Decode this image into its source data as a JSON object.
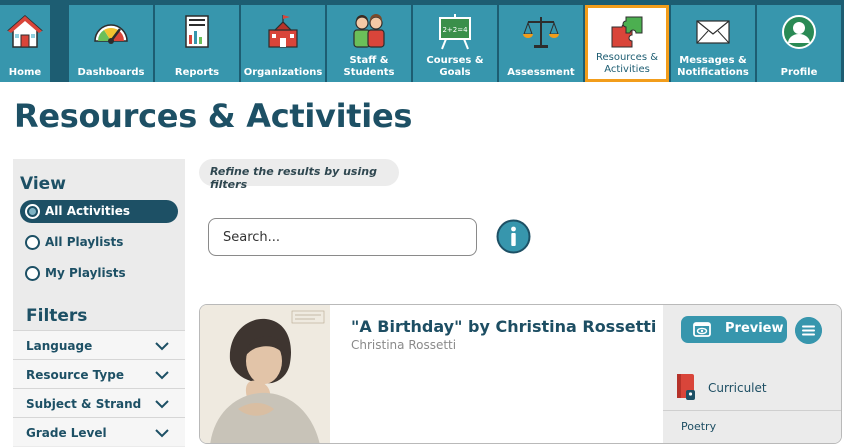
{
  "nav": {
    "items": [
      {
        "label": "Home",
        "icon": "house-icon"
      },
      {
        "label": "Dashboards",
        "icon": "gauge-icon"
      },
      {
        "label": "Reports",
        "icon": "report-icon"
      },
      {
        "label": "Organizations",
        "icon": "school-building-icon"
      },
      {
        "label": "Staff & Students",
        "icon": "people-icon"
      },
      {
        "label": "Courses & Goals",
        "icon": "chalkboard-icon"
      },
      {
        "label": "Assessment",
        "icon": "scales-icon"
      },
      {
        "label": "Resources & Activities",
        "icon": "puzzle-icon",
        "active": true
      },
      {
        "label": "Messages & Notifications",
        "icon": "envelope-icon"
      },
      {
        "label": "Profile",
        "icon": "user-icon"
      }
    ],
    "active_border_color": "#f29d1b",
    "bar_color": "#3796ad"
  },
  "page": {
    "title": "Resources & Activities"
  },
  "sidebar": {
    "view_heading": "View",
    "view_options": [
      {
        "label": "All Activities",
        "selected": true
      },
      {
        "label": "All Playlists",
        "selected": false
      },
      {
        "label": "My Playlists",
        "selected": false
      }
    ],
    "filters_heading": "Filters",
    "filters": [
      {
        "label": "Language"
      },
      {
        "label": "Resource Type"
      },
      {
        "label": "Subject & Strand"
      },
      {
        "label": "Grade Level"
      }
    ]
  },
  "main": {
    "refine_text": "Refine the results by using filters",
    "search": {
      "placeholder": "Search...",
      "value": ""
    },
    "info_icon": "info-icon",
    "cards": [
      {
        "title": "\"A Birthday\" by Christina Rossetti",
        "author": "Christina Rossetti",
        "preview_label": "Preview",
        "source": "Curriculet",
        "category": "Poetry"
      }
    ]
  },
  "colors": {
    "primary_dark": "#1d5065",
    "primary": "#3796ad",
    "accent": "#f29d1b"
  }
}
